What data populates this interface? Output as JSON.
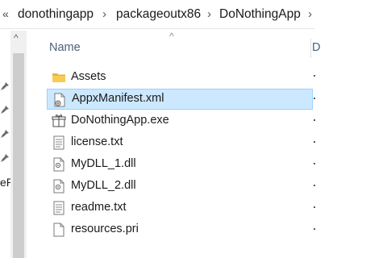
{
  "breadcrumb": {
    "overflow_icon": "double-chevron-left-icon",
    "items": [
      "donothingapp",
      "packageoutx86",
      "DoNothingApp"
    ],
    "separator_icon": "chevron-right-icon"
  },
  "nav_pane": {
    "partial_text": "eP"
  },
  "columns": {
    "name": "Name",
    "next": "D"
  },
  "files": [
    {
      "name": "Assets",
      "icon": "folder-icon"
    },
    {
      "name": "AppxManifest.xml",
      "icon": "xml-file-icon",
      "selected": true
    },
    {
      "name": "DoNothingApp.exe",
      "icon": "exe-file-icon"
    },
    {
      "name": "license.txt",
      "icon": "text-file-icon"
    },
    {
      "name": "MyDLL_1.dll",
      "icon": "dll-file-icon"
    },
    {
      "name": "MyDLL_2.dll",
      "icon": "dll-file-icon"
    },
    {
      "name": "readme.txt",
      "icon": "text-file-icon"
    },
    {
      "name": "resources.pri",
      "icon": "generic-file-icon"
    }
  ],
  "colors": {
    "selection_bg": "#cce8ff",
    "selection_border": "#99d1ff",
    "header_text": "#4c607a",
    "folder": "#e8b53e"
  }
}
